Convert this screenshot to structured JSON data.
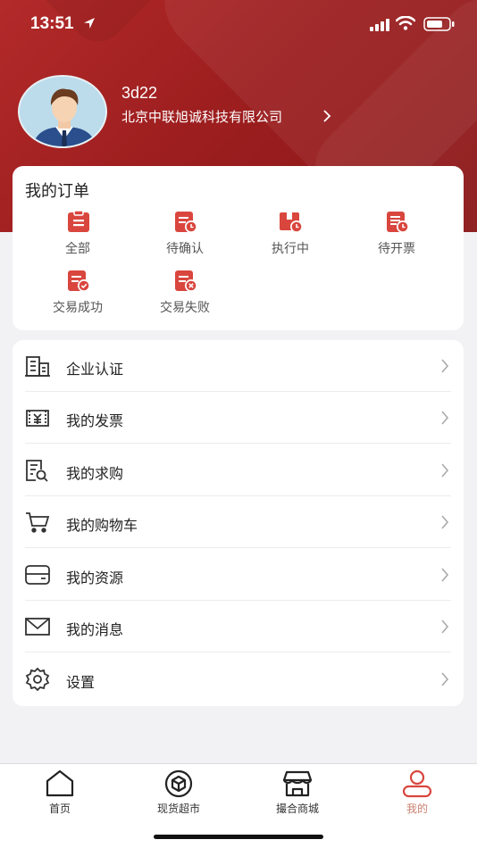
{
  "status_bar": {
    "time": "13:51"
  },
  "profile": {
    "username": "3d22",
    "company": "北京中联旭诚科技有限公司"
  },
  "orders": {
    "title": "我的订单",
    "items": [
      {
        "label": "全部",
        "icon": "clipboard-icon"
      },
      {
        "label": "待确认",
        "icon": "doc-clock-icon"
      },
      {
        "label": "执行中",
        "icon": "box-clock-icon"
      },
      {
        "label": "待开票",
        "icon": "invoice-clock-icon"
      },
      {
        "label": "交易成功",
        "icon": "doc-check-icon"
      },
      {
        "label": "交易失败",
        "icon": "doc-x-icon"
      }
    ]
  },
  "menu": [
    {
      "label": "企业认证",
      "icon": "building-icon"
    },
    {
      "label": "我的发票",
      "icon": "invoice-icon"
    },
    {
      "label": "我的求购",
      "icon": "doc-search-icon"
    },
    {
      "label": "我的购物车",
      "icon": "cart-icon"
    },
    {
      "label": "我的资源",
      "icon": "wallet-icon"
    },
    {
      "label": "我的消息",
      "icon": "mail-icon"
    },
    {
      "label": "设置",
      "icon": "gear-icon"
    }
  ],
  "tabbar": [
    {
      "label": "首页",
      "icon": "home-icon"
    },
    {
      "label": "现货超市",
      "icon": "cube-icon"
    },
    {
      "label": "撮合商城",
      "icon": "store-icon"
    },
    {
      "label": "我的",
      "icon": "user-icon",
      "active": true
    }
  ],
  "colors": {
    "brand": "#a52324",
    "icon_red": "#d9463e",
    "active_tab": "#c9806f"
  }
}
